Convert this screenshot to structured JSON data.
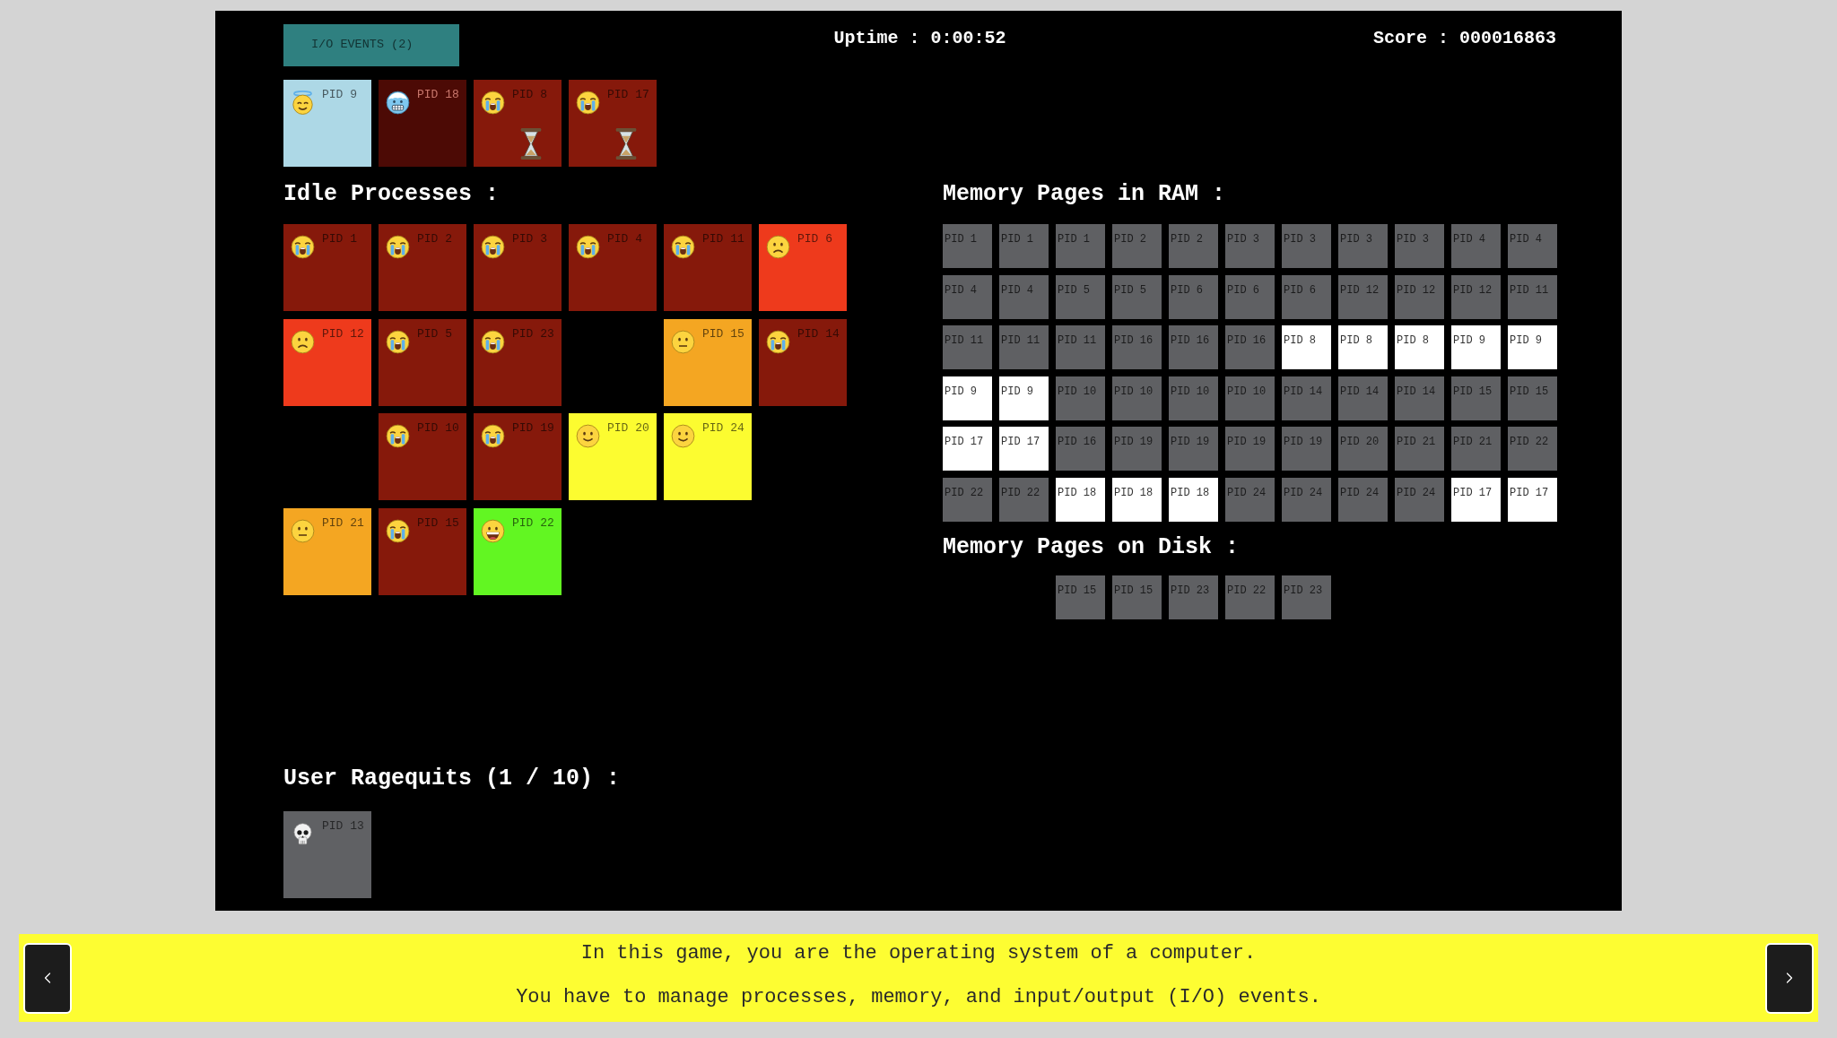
{
  "io_events_button": {
    "label": "I/O EVENTS (2)"
  },
  "uptime": "Uptime : 0:00:52",
  "score": "Score : 000016863",
  "cpu": [
    {
      "pid": "PID 9",
      "kind": "angel",
      "color": "#add8e6",
      "waiting": false
    },
    {
      "pid": "PID 18",
      "kind": "freezing",
      "color": "#4c0a05",
      "waiting": false
    },
    {
      "pid": "PID 8",
      "kind": "crying",
      "color": "#86190b",
      "waiting": true
    },
    {
      "pid": "PID 17",
      "kind": "crying",
      "color": "#86190b",
      "waiting": true
    }
  ],
  "idle_processes": {
    "title": "Idle Processes :",
    "rows": [
      [
        {
          "pid": "PID 1",
          "kind": "crying",
          "color": "#86190b"
        },
        {
          "pid": "PID 2",
          "kind": "crying",
          "color": "#86190b"
        },
        {
          "pid": "PID 3",
          "kind": "crying",
          "color": "#86190b"
        },
        {
          "pid": "PID 4",
          "kind": "crying",
          "color": "#86190b"
        },
        {
          "pid": "PID 11",
          "kind": "crying",
          "color": "#86190b"
        },
        {
          "pid": "PID 6",
          "kind": "frowning",
          "color": "#ee3a1c"
        }
      ],
      [
        {
          "pid": "PID 12",
          "kind": "frowning",
          "color": "#ee3a1c"
        },
        {
          "pid": "PID 5",
          "kind": "crying",
          "color": "#86190b"
        },
        {
          "pid": "PID 23",
          "kind": "crying",
          "color": "#86190b"
        },
        null,
        {
          "pid": "PID 15",
          "kind": "neutral",
          "color": "#f4a622"
        },
        {
          "pid": "PID 14",
          "kind": "crying",
          "color": "#86190b"
        }
      ],
      [
        null,
        {
          "pid": "PID 10",
          "kind": "crying",
          "color": "#86190b"
        },
        {
          "pid": "PID 19",
          "kind": "crying",
          "color": "#86190b"
        },
        {
          "pid": "PID 20",
          "kind": "smiling",
          "color": "#fcfc30"
        },
        {
          "pid": "PID 24",
          "kind": "smiling",
          "color": "#fcfc30"
        }
      ],
      [
        {
          "pid": "PID 21",
          "kind": "neutral",
          "color": "#f4a622"
        },
        {
          "pid": "PID 15",
          "kind": "crying",
          "color": "#86190b"
        },
        {
          "pid": "PID 22",
          "kind": "grinning",
          "color": "#62f622"
        }
      ]
    ]
  },
  "ram": {
    "title": "Memory Pages in RAM :",
    "pages": [
      {
        "label": "PID 1",
        "accessed": false
      },
      {
        "label": "PID 1",
        "accessed": false
      },
      {
        "label": "PID 1",
        "accessed": false
      },
      {
        "label": "PID 2",
        "accessed": false
      },
      {
        "label": "PID 2",
        "accessed": false
      },
      {
        "label": "PID 3",
        "accessed": false
      },
      {
        "label": "PID 3",
        "accessed": false
      },
      {
        "label": "PID 3",
        "accessed": false
      },
      {
        "label": "PID 3",
        "accessed": false
      },
      {
        "label": "PID 4",
        "accessed": false
      },
      {
        "label": "PID 4",
        "accessed": false
      },
      {
        "label": "PID 4",
        "accessed": false
      },
      {
        "label": "PID 4",
        "accessed": false
      },
      {
        "label": "PID 5",
        "accessed": false
      },
      {
        "label": "PID 5",
        "accessed": false
      },
      {
        "label": "PID 6",
        "accessed": false
      },
      {
        "label": "PID 6",
        "accessed": false
      },
      {
        "label": "PID 6",
        "accessed": false
      },
      {
        "label": "PID 12",
        "accessed": false
      },
      {
        "label": "PID 12",
        "accessed": false
      },
      {
        "label": "PID 12",
        "accessed": false
      },
      {
        "label": "PID 11",
        "accessed": false
      },
      {
        "label": "PID 11",
        "accessed": false
      },
      {
        "label": "PID 11",
        "accessed": false
      },
      {
        "label": "PID 11",
        "accessed": false
      },
      {
        "label": "PID 16",
        "accessed": false
      },
      {
        "label": "PID 16",
        "accessed": false
      },
      {
        "label": "PID 16",
        "accessed": false
      },
      {
        "label": "PID 8",
        "accessed": true
      },
      {
        "label": "PID 8",
        "accessed": true
      },
      {
        "label": "PID 8",
        "accessed": true
      },
      {
        "label": "PID 9",
        "accessed": true
      },
      {
        "label": "PID 9",
        "accessed": true
      },
      {
        "label": "PID 9",
        "accessed": true
      },
      {
        "label": "PID 9",
        "accessed": true
      },
      {
        "label": "PID 10",
        "accessed": false
      },
      {
        "label": "PID 10",
        "accessed": false
      },
      {
        "label": "PID 10",
        "accessed": false
      },
      {
        "label": "PID 10",
        "accessed": false
      },
      {
        "label": "PID 14",
        "accessed": false
      },
      {
        "label": "PID 14",
        "accessed": false
      },
      {
        "label": "PID 14",
        "accessed": false
      },
      {
        "label": "PID 15",
        "accessed": false
      },
      {
        "label": "PID 15",
        "accessed": false
      },
      {
        "label": "PID 17",
        "accessed": true
      },
      {
        "label": "PID 17",
        "accessed": true
      },
      {
        "label": "PID 16",
        "accessed": false
      },
      {
        "label": "PID 19",
        "accessed": false
      },
      {
        "label": "PID 19",
        "accessed": false
      },
      {
        "label": "PID 19",
        "accessed": false
      },
      {
        "label": "PID 19",
        "accessed": false
      },
      {
        "label": "PID 20",
        "accessed": false
      },
      {
        "label": "PID 21",
        "accessed": false
      },
      {
        "label": "PID 21",
        "accessed": false
      },
      {
        "label": "PID 22",
        "accessed": false
      },
      {
        "label": "PID 22",
        "accessed": false
      },
      {
        "label": "PID 22",
        "accessed": false
      },
      {
        "label": "PID 18",
        "accessed": true
      },
      {
        "label": "PID 18",
        "accessed": true
      },
      {
        "label": "PID 18",
        "accessed": true
      },
      {
        "label": "PID 24",
        "accessed": false
      },
      {
        "label": "PID 24",
        "accessed": false
      },
      {
        "label": "PID 24",
        "accessed": false
      },
      {
        "label": "PID 24",
        "accessed": false
      },
      {
        "label": "PID 17",
        "accessed": true
      },
      {
        "label": "PID 17",
        "accessed": true
      }
    ]
  },
  "disk": {
    "title": "Memory Pages on Disk :",
    "pages": [
      {
        "label": "PID 15"
      },
      {
        "label": "PID 15"
      },
      {
        "label": "PID 23"
      },
      {
        "label": "PID 22"
      },
      {
        "label": "PID 23"
      }
    ]
  },
  "ragequits": {
    "title": "User Ragequits (1 / 10) :",
    "processes": [
      {
        "pid": "PID 13",
        "kind": "skull",
        "color": "#606164"
      }
    ]
  },
  "tutorial": {
    "lines": [
      "In this game, you are the operating system of a computer.",
      "You have to manage processes, memory, and input/output (I/O) events."
    ]
  }
}
